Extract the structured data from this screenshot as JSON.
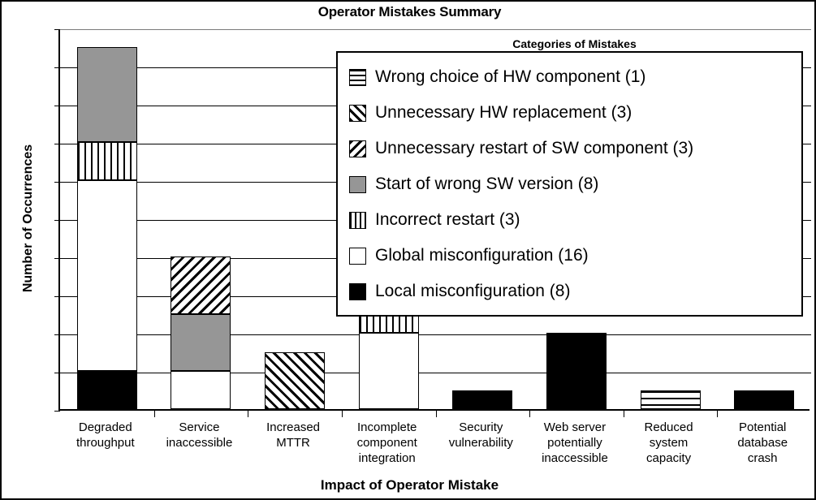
{
  "chart_data": {
    "type": "bar",
    "subtype": "stacked-bar",
    "title": "Operator Mistakes Summary",
    "xlabel": "Impact of Operator Mistake",
    "ylabel": "Number of Occurrences",
    "ylim": [
      0,
      20
    ],
    "ytick_labels": [
      "0",
      "2",
      "4",
      "6",
      "8",
      "10",
      "12",
      "14",
      "16",
      "18",
      "20"
    ],
    "ytick_values": [
      0,
      2,
      4,
      6,
      8,
      10,
      12,
      14,
      16,
      18,
      20
    ],
    "grid": true,
    "legend_position": "inside-top-right",
    "legend_title": "Categories of Mistakes",
    "categories": [
      "Degraded throughput",
      "Service inaccessible",
      "Increased MTTR",
      "Incomplete component integration",
      "Security vulnerability",
      "Web server potentially inaccessible",
      "Reduced system capacity",
      "Potential database crash"
    ],
    "category_lines": [
      [
        "Degraded",
        "throughput"
      ],
      [
        "Service",
        "inaccessible"
      ],
      [
        "Increased",
        "MTTR"
      ],
      [
        "Incomplete",
        "component",
        "integration"
      ],
      [
        "Security",
        "vulnerability"
      ],
      [
        "Web server",
        "potentially",
        "inaccessible"
      ],
      [
        "Reduced",
        "system",
        "capacity"
      ],
      [
        "Potential",
        "database",
        "crash"
      ]
    ],
    "series": [
      {
        "name": "Local misconfiguration",
        "total": 8,
        "pattern": "solid-black",
        "values": [
          2,
          0,
          0,
          0,
          1,
          4,
          0,
          1
        ]
      },
      {
        "name": "Global misconfiguration",
        "total": 16,
        "pattern": "solid-white",
        "values": [
          10,
          2,
          0,
          4,
          0,
          0,
          0,
          0
        ]
      },
      {
        "name": "Incorrect restart",
        "total": 3,
        "pattern": "vertical-lines",
        "values": [
          2,
          0,
          0,
          1,
          0,
          0,
          0,
          0
        ]
      },
      {
        "name": "Start of wrong SW version",
        "total": 8,
        "pattern": "solid-gray",
        "values": [
          5,
          3,
          0,
          0,
          0,
          0,
          0,
          0
        ]
      },
      {
        "name": "Unnecessary restart of SW component",
        "total": 3,
        "pattern": "backslash-hatch",
        "values": [
          0,
          3,
          0,
          0,
          0,
          0,
          0,
          0
        ]
      },
      {
        "name": "Unnecessary HW replacement",
        "total": 3,
        "pattern": "forwardslash-hatch",
        "values": [
          0,
          0,
          3,
          0,
          0,
          0,
          0,
          0
        ]
      },
      {
        "name": "Wrong choice of HW component",
        "total": 1,
        "pattern": "horizontal-lines",
        "values": [
          0,
          0,
          0,
          0,
          0,
          0,
          1,
          0
        ]
      }
    ],
    "bar_totals": [
      19,
      8,
      3,
      5,
      1,
      4,
      1,
      1
    ],
    "legend_entries": [
      {
        "label": "Wrong choice of HW component (1)",
        "pattern": "horizontal-lines",
        "count": 1
      },
      {
        "label": "Unnecessary HW replacement (3)",
        "pattern": "forwardslash-hatch",
        "count": 3
      },
      {
        "label": "Unnecessary restart of SW component (3)",
        "pattern": "backslash-hatch",
        "count": 3
      },
      {
        "label": "Start of wrong SW version (8)",
        "pattern": "solid-gray",
        "count": 8
      },
      {
        "label": "Incorrect restart (3)",
        "pattern": "vertical-lines",
        "count": 3
      },
      {
        "label": "Global misconfiguration (16)",
        "pattern": "solid-white",
        "count": 16
      },
      {
        "label": "Local misconfiguration (8)",
        "pattern": "solid-black",
        "count": 8
      }
    ],
    "colors": {
      "gray_fill": "#969696",
      "black_fill": "#000000",
      "white_fill": "#ffffff",
      "axis": "#000000",
      "gridline": "#000000"
    },
    "stacks": [
      {
        "category": "Degraded throughput",
        "segments": [
          {
            "series": "Local misconfiguration",
            "from": 0,
            "to": 2,
            "pattern": "solid-black"
          },
          {
            "series": "Global misconfiguration",
            "from": 2,
            "to": 12,
            "pattern": "solid-white"
          },
          {
            "series": "Incorrect restart",
            "from": 12,
            "to": 14,
            "pattern": "vertical-lines"
          },
          {
            "series": "Start of wrong SW version",
            "from": 14,
            "to": 19,
            "pattern": "solid-gray"
          }
        ]
      },
      {
        "category": "Service inaccessible",
        "segments": [
          {
            "series": "Global misconfiguration",
            "from": 0,
            "to": 2,
            "pattern": "solid-white"
          },
          {
            "series": "Start of wrong SW version",
            "from": 2,
            "to": 5,
            "pattern": "solid-gray"
          },
          {
            "series": "Unnecessary restart of SW component",
            "from": 5,
            "to": 8,
            "pattern": "backslash-hatch"
          }
        ]
      },
      {
        "category": "Increased MTTR",
        "segments": [
          {
            "series": "Unnecessary HW replacement",
            "from": 0,
            "to": 3,
            "pattern": "forwardslash-hatch"
          }
        ]
      },
      {
        "category": "Incomplete component integration",
        "segments": [
          {
            "series": "Global misconfiguration",
            "from": 0,
            "to": 4,
            "pattern": "solid-white"
          },
          {
            "series": "Incorrect restart",
            "from": 4,
            "to": 5,
            "pattern": "vertical-lines"
          }
        ]
      },
      {
        "category": "Security vulnerability",
        "segments": [
          {
            "series": "Local misconfiguration",
            "from": 0,
            "to": 1,
            "pattern": "solid-black"
          }
        ]
      },
      {
        "category": "Web server potentially inaccessible",
        "segments": [
          {
            "series": "Local misconfiguration",
            "from": 0,
            "to": 4,
            "pattern": "solid-black"
          }
        ]
      },
      {
        "category": "Reduced system capacity",
        "segments": [
          {
            "series": "Wrong choice of HW component",
            "from": 0,
            "to": 1,
            "pattern": "horizontal-lines"
          }
        ]
      },
      {
        "category": "Potential database crash",
        "segments": [
          {
            "series": "Local misconfiguration",
            "from": 0,
            "to": 1,
            "pattern": "solid-black"
          }
        ]
      }
    ]
  }
}
